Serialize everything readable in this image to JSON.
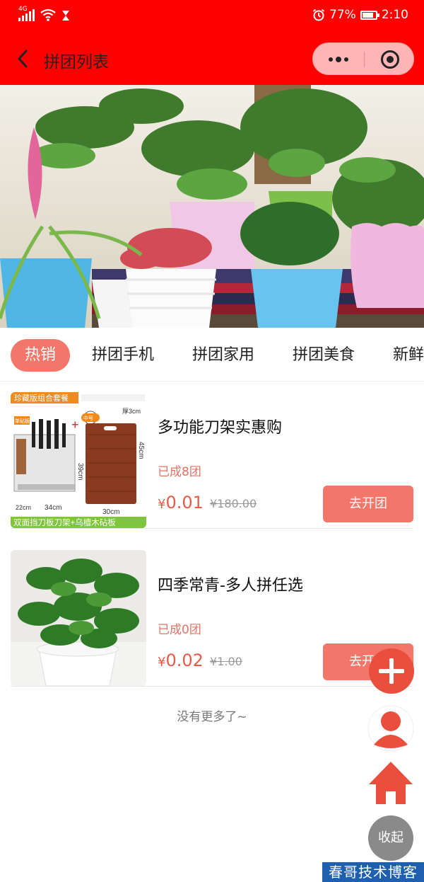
{
  "status_bar": {
    "network": "4G",
    "battery": "77%",
    "time": "2:10"
  },
  "nav": {
    "title": "拼团列表"
  },
  "tabs": [
    {
      "label": "热销",
      "active": true
    },
    {
      "label": "拼团手机"
    },
    {
      "label": "拼团家用"
    },
    {
      "label": "拼团美食"
    },
    {
      "label": "新鲜"
    }
  ],
  "products": [
    {
      "title": "多功能刀架实惠购",
      "sold": "已成8团",
      "price": "0.01",
      "original_price": "¥180.00",
      "button": "去开团",
      "thumb": {
        "top_banner": "珍藏版组合套餐",
        "label_single": "单砧板位",
        "label_medium": "中号",
        "dim_thickness": "厚3cm",
        "dim_height_board": "45cm",
        "dim_height_rack": "39cm",
        "dim_width_small": "22cm",
        "dim_width_rack": "34cm",
        "dim_width_board": "30cm",
        "bottom_banner": "双面挡刀板刀架+乌檀木砧板"
      }
    },
    {
      "title": "四季常青-多人拼任选",
      "sold": "已成0团",
      "price": "0.02",
      "original_price": "¥1.00",
      "button": "去开团"
    }
  ],
  "currency": "¥",
  "no_more": "没有更多了~",
  "fab": {
    "collapse": "收起"
  },
  "watermark": "春哥技术博客",
  "colors": {
    "header": "#ff0000",
    "accent": "#f27669",
    "price": "#e85b4a",
    "fab_red": "#e94f3c"
  }
}
